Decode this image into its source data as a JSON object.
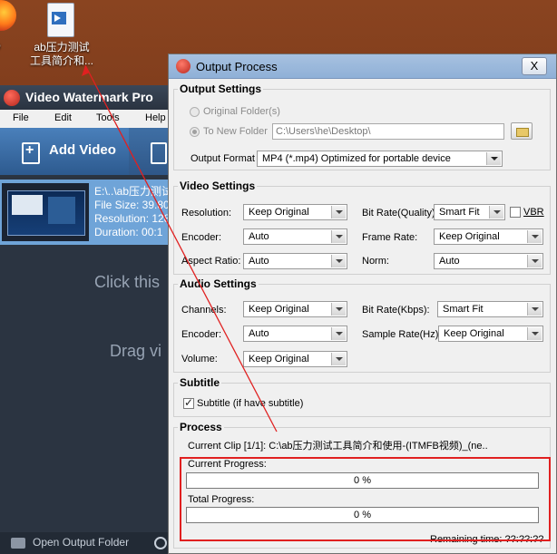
{
  "desktop": {
    "icon_label_line1": "ab压力测试",
    "icon_label_line2": "工具简介和...",
    "left_edge_label": "o"
  },
  "app": {
    "title": "Video Watermark Pro",
    "menu": [
      "File",
      "Edit",
      "Tools",
      "Help"
    ],
    "add_video": "Add Video",
    "clip": {
      "path": "E:\\..\\ab压力测试",
      "size": "File Size: 39.80",
      "resolution": "Resolution: 128",
      "duration": "Duration: 00:1"
    },
    "hint1": "Click this",
    "hint2": "Drag vi",
    "open_output_folder": "Open Output Folder"
  },
  "dialog": {
    "title": "Output Process",
    "close": "X",
    "output_settings": {
      "heading": "Output Settings",
      "original_folder": "Original Folder(s)",
      "to_new_folder": "To New Folder",
      "folder_path": "C:\\Users\\he\\Desktop\\",
      "output_format_label": "Output Format :",
      "output_format": "MP4  (*.mp4) Optimized for portable device"
    },
    "video_settings": {
      "heading": "Video Settings",
      "resolution_label": "Resolution:",
      "resolution": "Keep Original",
      "encoder_label": "Encoder:",
      "encoder": "Auto",
      "aspect_label": "Aspect Ratio:",
      "aspect": "Auto",
      "bitrate_label": "Bit Rate(Quality):",
      "bitrate": "Smart Fit",
      "vbr_label": "VBR",
      "framerate_label": "Frame Rate:",
      "framerate": "Keep Original",
      "norm_label": "Norm:",
      "norm": "Auto"
    },
    "audio_settings": {
      "heading": "Audio Settings",
      "channels_label": "Channels:",
      "channels": "Keep Original",
      "encoder_label": "Encoder:",
      "encoder": "Auto",
      "volume_label": "Volume:",
      "volume": "Keep Original",
      "bitrate_label": "Bit Rate(Kbps):",
      "bitrate": "Smart Fit",
      "samplerate_label": "Sample Rate(Hz):",
      "samplerate": "Keep Original"
    },
    "subtitle": {
      "heading": "Subtitle",
      "checkbox_label": "Subtitle (if have subtitle)",
      "checked": true
    },
    "process": {
      "heading": "Process",
      "current_clip": "Current Clip [1/1]: C:\\ab压力测试工具简介和使用-(ITMFB视频)_(ne..",
      "current_progress_label": "Current Progress:",
      "current_progress": 0,
      "current_progress_text": "0 %",
      "total_progress_label": "Total Progress:",
      "total_progress": 0,
      "total_progress_text": "0 %",
      "remaining": "Remaining time: ??:??:??"
    }
  },
  "colors": {
    "annotation": "#e02020",
    "desktop": "#7a3a1a",
    "app_bg": "#2b3441",
    "dialog_bg": "#f0f0f0"
  }
}
